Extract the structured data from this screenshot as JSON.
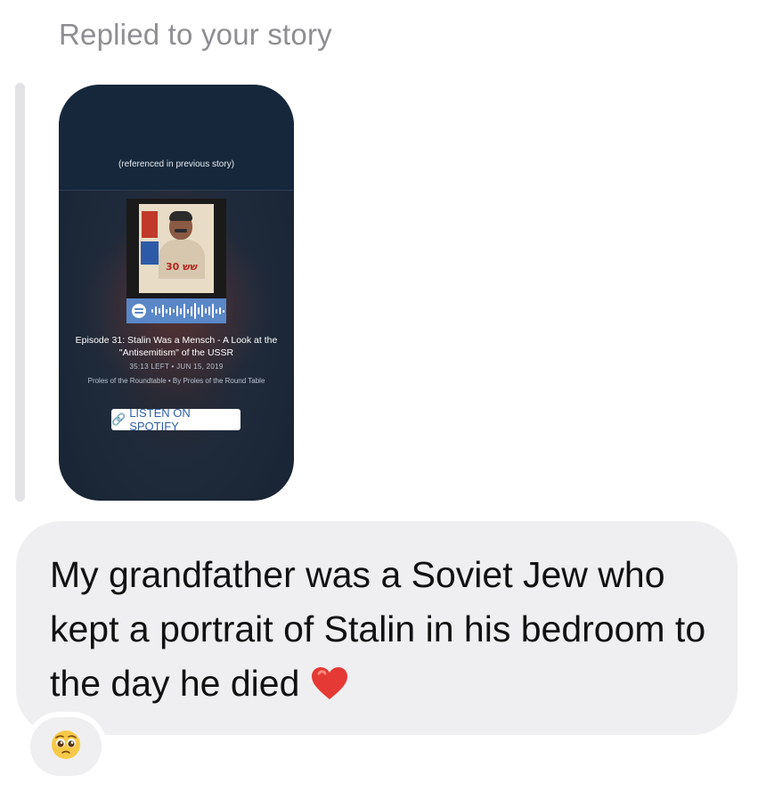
{
  "header": {
    "replied_label": "Replied to your story"
  },
  "story": {
    "reference_note": "(referenced in previous story)",
    "cover_text": "שש 30",
    "episode_title": "Episode 31: Stalin Was a Mensch - A Look at the \"Antisemitism\" of the USSR",
    "meta": "35:13 LEFT • JUN 15, 2019",
    "show": "Proles of the Roundtable • By Proles of the Round Table",
    "listen_label": "LISTEN ON SPOTIFY",
    "spotify_color": "#5a87c8"
  },
  "message": {
    "text": "My grandfather was a Soviet Jew who kept a portrait of Stalin in his bedroom to the day he died",
    "emoji_icon": "red-heart-icon",
    "bubble_color": "#efeff1"
  },
  "reaction": {
    "emoji_icon": "pleading-face-icon"
  }
}
